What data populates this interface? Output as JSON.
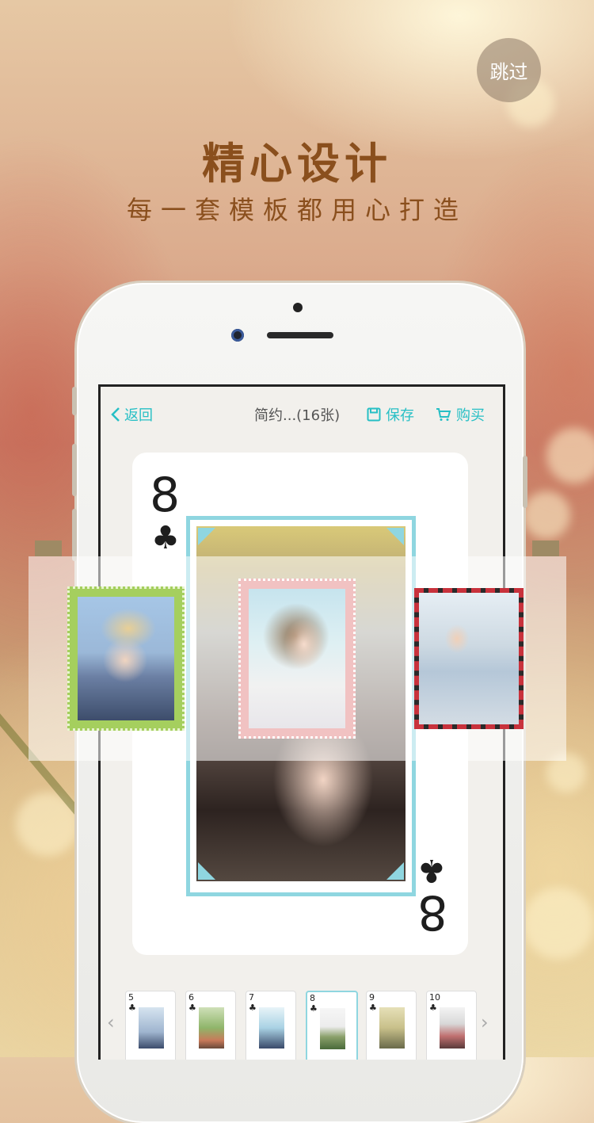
{
  "skip_label": "跳过",
  "headline": "精心设计",
  "subline": "每一套模板都用心打造",
  "app": {
    "nav": {
      "back_label": "返回",
      "title": "简约...(16张)",
      "save_label": "保存",
      "buy_label": "购买"
    },
    "card": {
      "rank": "8",
      "suit": "♣"
    },
    "thumbnails": [
      {
        "rank": "5",
        "suit": "♣",
        "selected": false
      },
      {
        "rank": "6",
        "suit": "♣",
        "selected": false
      },
      {
        "rank": "7",
        "suit": "♣",
        "selected": false
      },
      {
        "rank": "8",
        "suit": "♣",
        "selected": true
      },
      {
        "rank": "9",
        "suit": "♣",
        "selected": false
      },
      {
        "rank": "10",
        "suit": "♣",
        "selected": false
      }
    ]
  },
  "colors": {
    "accent": "#27bfc5",
    "title_brown": "#8a4f1d",
    "card_frame": "#8fd6e0",
    "left_frame": "#a5cf5e",
    "mid_frame": "#f1c2c2",
    "right_frame": "#c8323c"
  },
  "icons": {
    "back": "chevron-left-icon",
    "save": "floppy-icon",
    "buy": "cart-icon",
    "thumb_prev": "chevron-left-icon",
    "thumb_next": "chevron-right-icon"
  }
}
